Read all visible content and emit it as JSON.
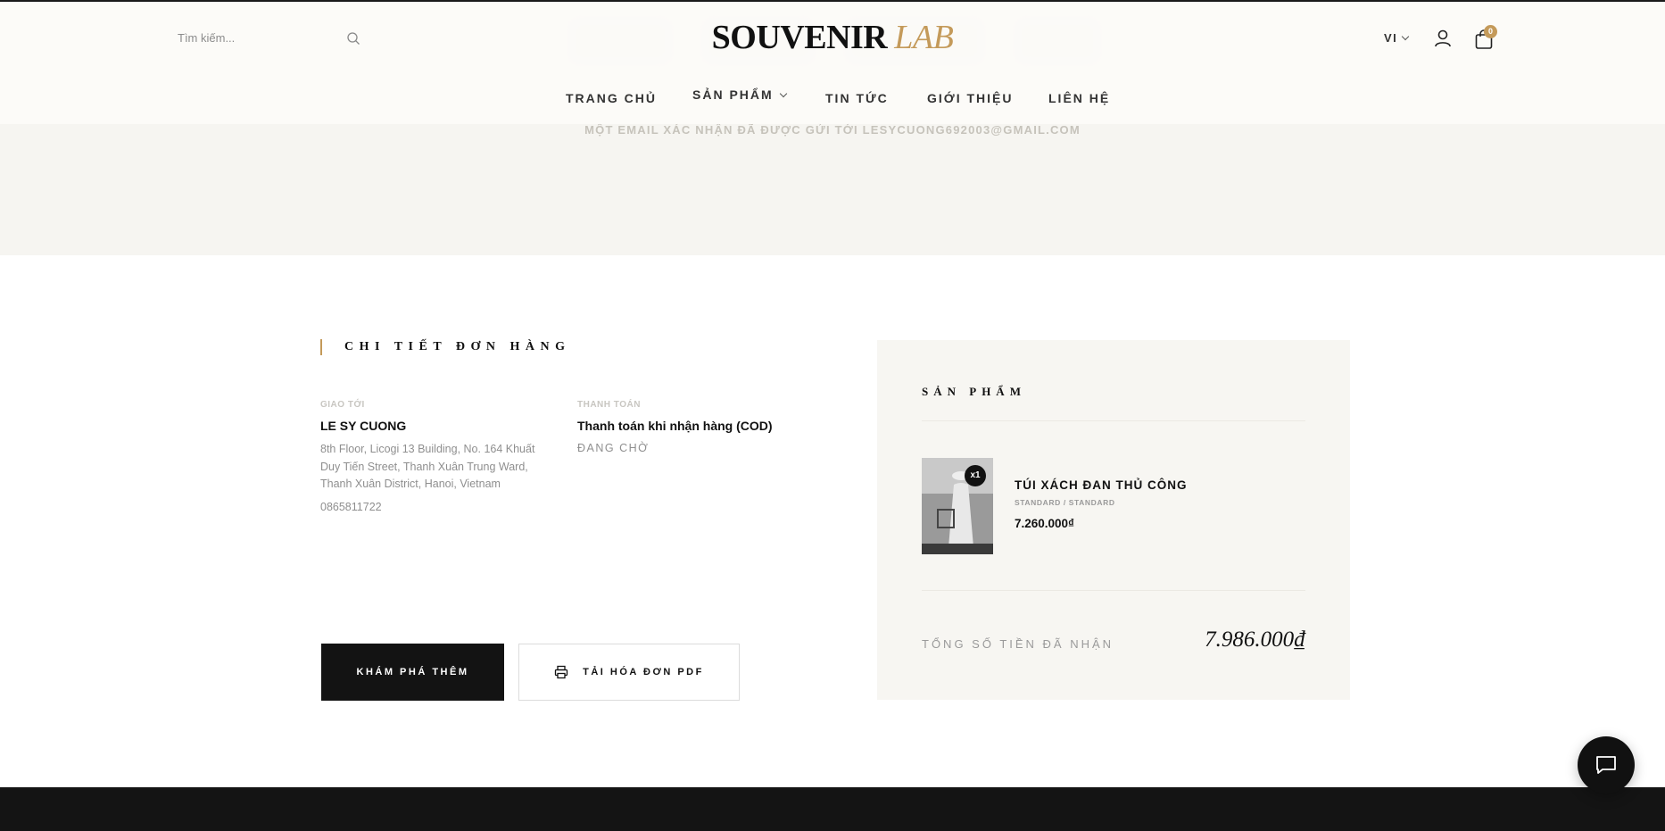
{
  "header": {
    "search_placeholder": "Tìm kiếm...",
    "logo_primary": "SOUVENIR",
    "logo_accent": "LAB",
    "lang": "VI",
    "cart_count": "0",
    "nav": [
      {
        "label": "TRANG CHỦ"
      },
      {
        "label": "SẢN PHẨM"
      },
      {
        "label": "TIN TỨC"
      },
      {
        "label": "GIỚI THIỆU"
      },
      {
        "label": "LIÊN HỆ"
      }
    ]
  },
  "hero": {
    "subtitle": "MỘT EMAIL XÁC NHẬN ĐÃ ĐƯỢC GỬI TỚI LESYCUONG692003@GMAIL.COM"
  },
  "order": {
    "heading": "CHI TIẾT ĐƠN HÀNG",
    "shipping": {
      "label": "GIAO TỚI",
      "name": "LE SY CUONG",
      "address": "8th Floor, Licogi 13 Building, No. 164 Khuất Duy Tiến Street, Thanh Xuân Trung Ward, Thanh Xuân District, Hanoi, Vietnam",
      "phone": "0865811722"
    },
    "payment": {
      "label": "THANH TOÁN",
      "method": "Thanh toán khi nhận hàng (COD)",
      "status": "ĐANG CHỜ"
    },
    "actions": {
      "explore": "KHÁM PHÁ THÊM",
      "download": "TẢI HÓA ĐƠN PDF"
    }
  },
  "summary": {
    "title": "SẢN PHẨM",
    "product": {
      "name": "TÚI XÁCH ĐAN THỦ CÔNG",
      "variant": "STANDARD / STANDARD",
      "price": "7.260.000₫",
      "quantity": "x1"
    },
    "total_label": "TỔNG SỐ TIỀN ĐÃ NHẬN",
    "total_value": "7.986.000₫"
  },
  "colors": {
    "accent": "#c49a5a",
    "dark": "#131313",
    "card_bg": "#f7f6f2"
  }
}
